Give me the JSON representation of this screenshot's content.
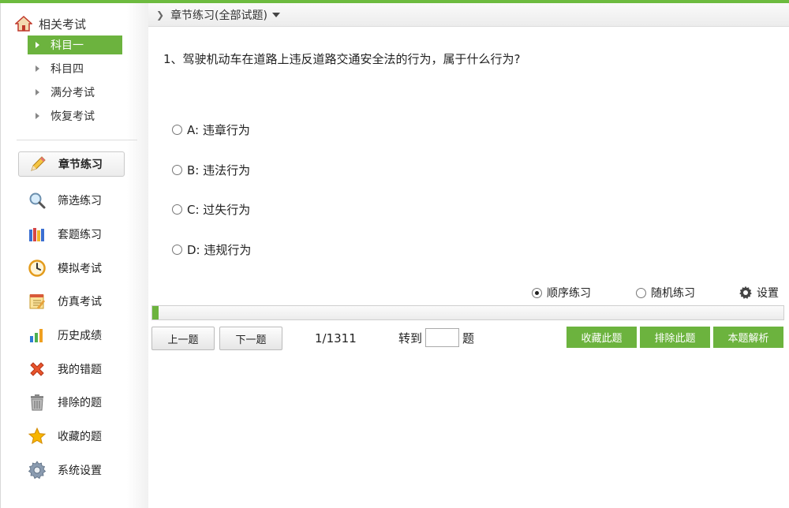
{
  "sidebar": {
    "header": "相关考试",
    "subjects": [
      {
        "label": "科目一",
        "active": true
      },
      {
        "label": "科目四",
        "active": false
      },
      {
        "label": "满分考试",
        "active": false
      },
      {
        "label": "恢复考试",
        "active": false
      }
    ],
    "menu": [
      {
        "label": "章节练习",
        "icon": "pencil-icon",
        "active": true
      },
      {
        "label": "筛选练习",
        "icon": "magnifier-icon",
        "active": false
      },
      {
        "label": "套题练习",
        "icon": "books-icon",
        "active": false
      },
      {
        "label": "模拟考试",
        "icon": "clock-icon",
        "active": false
      },
      {
        "label": "仿真考试",
        "icon": "notepad-icon",
        "active": false
      },
      {
        "label": "历史成绩",
        "icon": "bar-chart-icon",
        "active": false
      },
      {
        "label": "我的错题",
        "icon": "red-x-icon",
        "active": false
      },
      {
        "label": "排除的题",
        "icon": "trash-icon",
        "active": false
      },
      {
        "label": "收藏的题",
        "icon": "star-icon",
        "active": false
      },
      {
        "label": "系统设置",
        "icon": "gear-icon",
        "active": false
      }
    ]
  },
  "breadcrumb": {
    "label": "章节练习(全部试题)"
  },
  "question": {
    "text": "1、驾驶机动车在道路上违反道路交通安全法的行为，属于什么行为?",
    "options": [
      {
        "label": "A: 违章行为"
      },
      {
        "label": "B: 违法行为"
      },
      {
        "label": "C: 过失行为"
      },
      {
        "label": "D: 违规行为"
      }
    ]
  },
  "modes": {
    "sequential": "顺序练习",
    "random": "随机练习",
    "settings": "设置",
    "selected": "sequential"
  },
  "progress": {
    "fraction": 0.0008
  },
  "nav": {
    "prev": "上一题",
    "next": "下一题",
    "counter": "1/1311",
    "goto_prefix": "转到",
    "goto_value": "",
    "goto_suffix": "题"
  },
  "actions": {
    "favorite": "收藏此题",
    "exclude": "排除此题",
    "explain": "本题解析"
  },
  "colors": {
    "accent": "#6cb33e"
  }
}
